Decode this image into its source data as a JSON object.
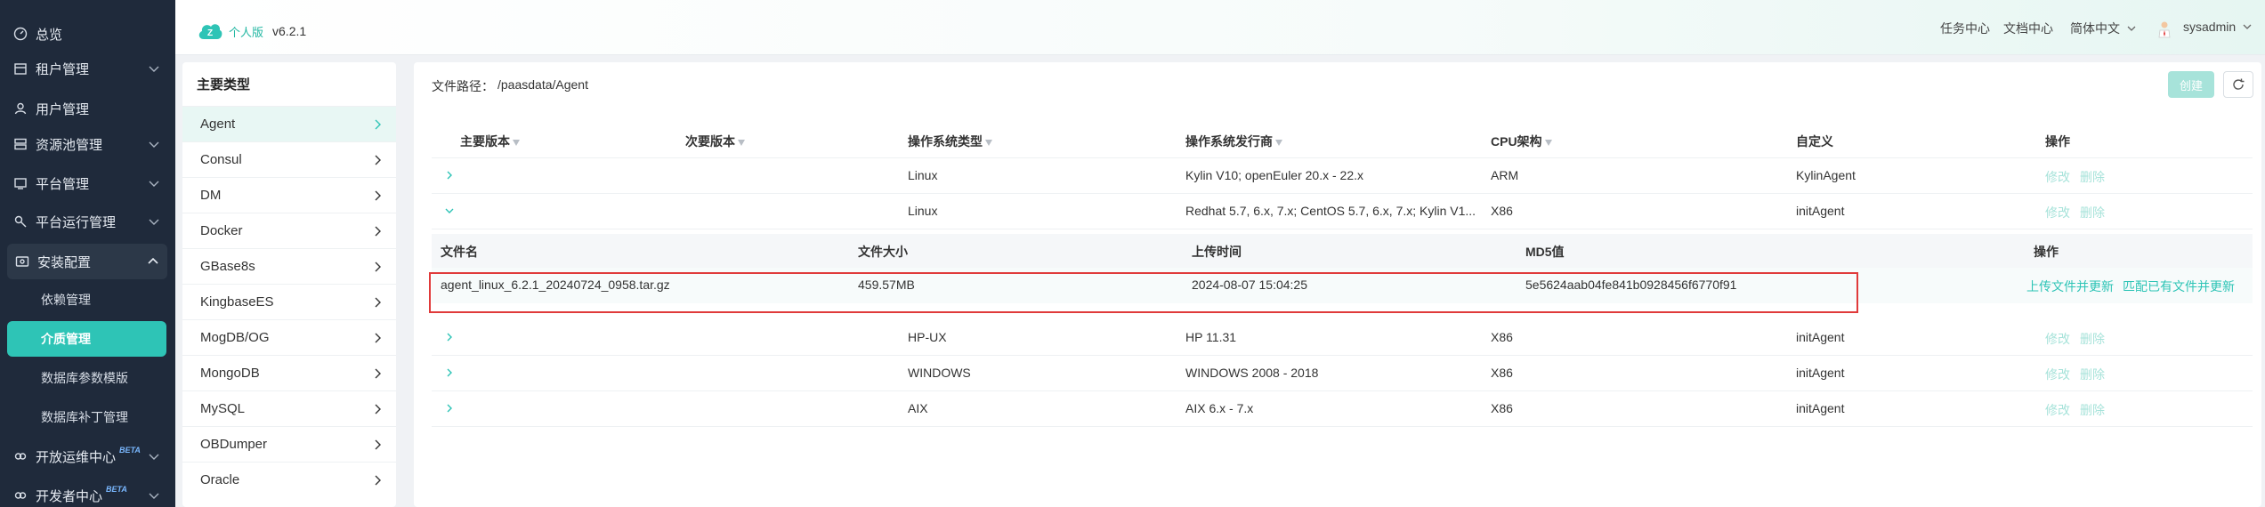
{
  "sidebar": {
    "items": [
      {
        "label": "总览",
        "icon": "dashboard-icon"
      },
      {
        "label": "租户管理",
        "icon": "tenant-icon"
      },
      {
        "label": "用户管理",
        "icon": "user-icon"
      },
      {
        "label": "资源池管理",
        "icon": "resource-pool-icon"
      },
      {
        "label": "平台管理",
        "icon": "platform-icon"
      },
      {
        "label": "平台运行管理",
        "icon": "platform-run-icon"
      },
      {
        "label": "安装配置",
        "icon": "install-config-icon"
      },
      {
        "label": "开放运维中心",
        "icon": "open-ops-icon",
        "badge": "BETA"
      },
      {
        "label": "开发者中心",
        "icon": "developer-icon",
        "badge": "BETA"
      }
    ],
    "subitems": [
      {
        "label": "依赖管理"
      },
      {
        "label": "介质管理"
      },
      {
        "label": "数据库参数模版"
      },
      {
        "label": "数据库补丁管理"
      }
    ]
  },
  "header": {
    "logo_text": "个人版",
    "version": "v6.2.1",
    "task_center": "任务中心",
    "doc_center": "文档中心",
    "language": "简体中文",
    "username": "sysadmin"
  },
  "type_panel": {
    "title": "主要类型",
    "items": [
      "Agent",
      "Consul",
      "DM",
      "Docker",
      "GBase8s",
      "KingbaseES",
      "MogDB/OG",
      "MongoDB",
      "MySQL",
      "OBDumper",
      "Oracle"
    ]
  },
  "main": {
    "path_label": "文件路径：",
    "path_value": "/paasdata/Agent",
    "create_label": "创建",
    "columns": [
      "主要版本",
      "次要版本",
      "操作系统类型",
      "操作系统发行商",
      "CPU架构",
      "自定义",
      "操作"
    ],
    "rows": [
      {
        "os_type": "Linux",
        "os_vendor": "Kylin V10; openEuler 20.x - 22.x",
        "cpu": "ARM",
        "custom": "KylinAgent",
        "edit": "修改",
        "delete": "删除"
      },
      {
        "os_type": "Linux",
        "os_vendor": "Redhat 5.7, 6.x, 7.x; CentOS 5.7, 6.x, 7.x; Kylin V1...",
        "cpu": "X86",
        "custom": "initAgent",
        "edit": "修改",
        "delete": "删除"
      },
      {
        "os_type": "HP-UX",
        "os_vendor": "HP 11.31",
        "cpu": "X86",
        "custom": "initAgent",
        "edit": "修改",
        "delete": "删除"
      },
      {
        "os_type": "WINDOWS",
        "os_vendor": "WINDOWS 2008 - 2018",
        "cpu": "X86",
        "custom": "initAgent",
        "edit": "修改",
        "delete": "删除"
      },
      {
        "os_type": "AIX",
        "os_vendor": "AIX 6.x - 7.x",
        "cpu": "X86",
        "custom": "initAgent",
        "edit": "修改",
        "delete": "删除"
      }
    ],
    "sub_columns": [
      "文件名",
      "文件大小",
      "上传时间",
      "MD5值",
      "操作"
    ],
    "sub_row": {
      "filename": "agent_linux_6.2.1_20240724_0958.tar.gz",
      "size": "459.57MB",
      "upload_time": "2024-08-07 15:04:25",
      "md5": "5e5624aab04fe841b0928456f6770f91",
      "upload_update": "上传文件并更新",
      "match_update": "匹配已有文件并更新"
    }
  },
  "colors": {
    "accent": "#2ec4b6",
    "nav_bg": "#1f2a3b",
    "highlight": "#e03a3a"
  }
}
